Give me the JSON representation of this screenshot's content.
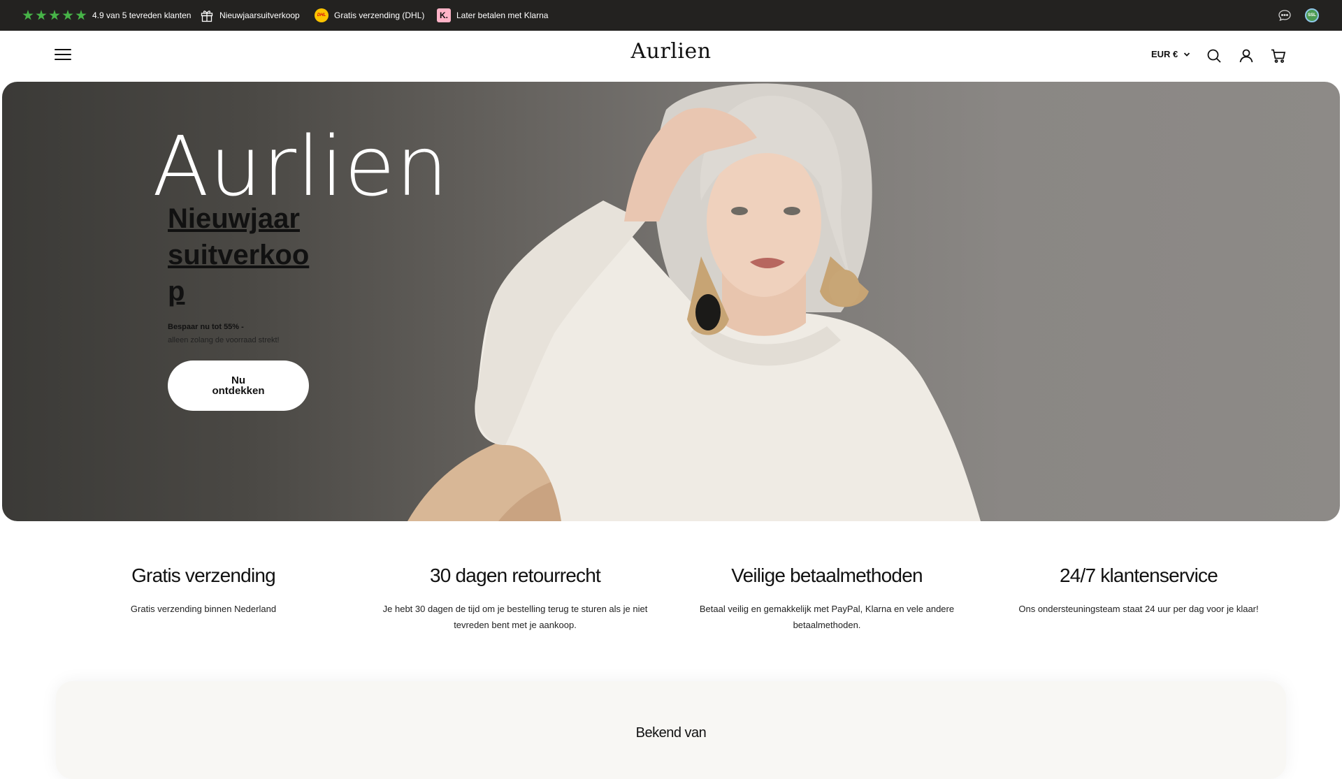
{
  "announcement": {
    "rating_text": "4.9 van 5 tevreden klanten",
    "sale_text": "Nieuwjaarsuitverkoop",
    "dhl_text": "Gratis verzending (DHL)",
    "dhl_badge": "DHL",
    "klarna_text": "Later betalen met Klarna",
    "klarna_badge": "K.",
    "ssl_badge": "SSL",
    "icons": [
      "star-icon",
      "gift-icon",
      "dhl-icon",
      "klarna-icon",
      "chat-icon",
      "ssl-icon"
    ],
    "star_color": "#47b448",
    "background": "#232220"
  },
  "header": {
    "logo": "Aurlien",
    "currency": "EUR €",
    "icons": [
      "menu-icon",
      "chevron-down-icon",
      "search-icon",
      "account-icon",
      "cart-icon"
    ]
  },
  "hero": {
    "brand": "Aurlien",
    "title": "Nieuwjaar suitverkoop",
    "subtitle_bold": "Bespaar nu tot 55% -",
    "subtitle": "alleen zolang de voorraad strekt!",
    "button": "Nu ontdekken"
  },
  "features": [
    {
      "title": "Gratis verzending",
      "text": "Gratis verzending binnen Nederland"
    },
    {
      "title": "30 dagen retourrecht",
      "text": "Je hebt 30 dagen de tijd om je bestelling terug te sturen als je niet tevreden bent met je aankoop."
    },
    {
      "title": "Veilige betaalmethoden",
      "text": "Betaal veilig en gemakkelijk met PayPal, Klarna en vele andere betaalmethoden."
    },
    {
      "title": "24/7 klantenservice",
      "text": "Ons ondersteuningsteam staat 24 uur per dag voor je klaar!"
    }
  ],
  "known_from": {
    "title": "Bekend van"
  }
}
